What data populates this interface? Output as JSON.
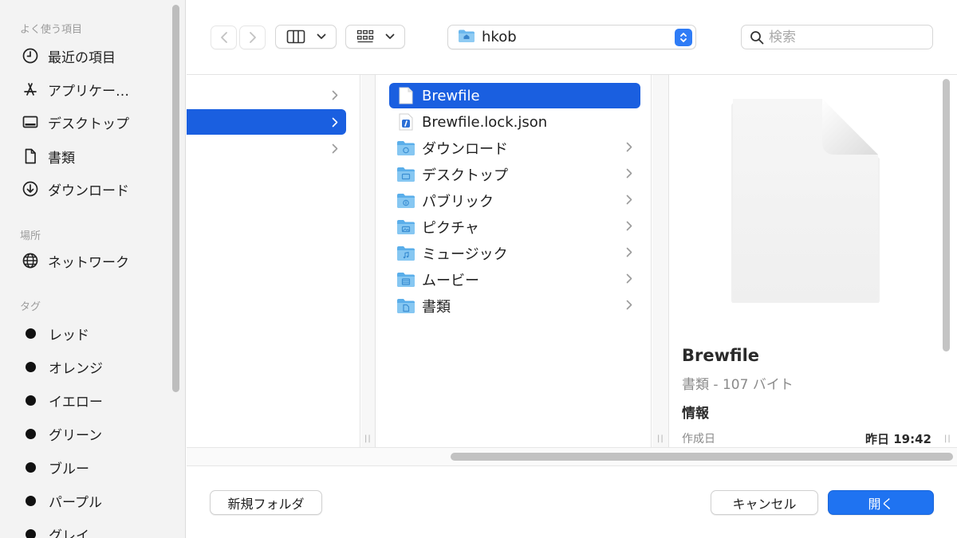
{
  "sidebar": {
    "sections": {
      "recents": "よく使う項目",
      "locations": "場所",
      "tags": "タグ"
    },
    "favorites": [
      {
        "label": "最近の項目",
        "icon": "clock-icon"
      },
      {
        "label": "アプリケー…",
        "icon": "applications-icon"
      },
      {
        "label": "デスクトップ",
        "icon": "desktop-icon"
      },
      {
        "label": "書類",
        "icon": "document-icon"
      },
      {
        "label": "ダウンロード",
        "icon": "download-icon"
      }
    ],
    "locations": [
      {
        "label": "ネットワーク",
        "icon": "network-icon"
      }
    ],
    "tags": [
      {
        "label": "レッド"
      },
      {
        "label": "オレンジ"
      },
      {
        "label": "イエロー"
      },
      {
        "label": "グリーン"
      },
      {
        "label": "ブルー"
      },
      {
        "label": "パープル"
      },
      {
        "label": "グレイ"
      }
    ]
  },
  "toolbar": {
    "path": "hkob",
    "search_placeholder": "検索"
  },
  "files": [
    {
      "name": "Brewfile",
      "type": "file",
      "selected": true
    },
    {
      "name": "Brewfile.lock.json",
      "type": "json",
      "selected": false
    },
    {
      "name": "ダウンロード",
      "type": "folder",
      "selected": false
    },
    {
      "name": "デスクトップ",
      "type": "folder",
      "selected": false
    },
    {
      "name": "パブリック",
      "type": "folder",
      "selected": false
    },
    {
      "name": "ピクチャ",
      "type": "folder",
      "selected": false
    },
    {
      "name": "ミュージック",
      "type": "folder",
      "selected": false
    },
    {
      "name": "ムービー",
      "type": "folder",
      "selected": false
    },
    {
      "name": "書類",
      "type": "folder",
      "selected": false
    }
  ],
  "preview": {
    "name": "Brewfile",
    "kind_size": "書類 - 107 バイト",
    "info_heading": "情報",
    "created_label": "作成日",
    "created_value": "昨日 19:42"
  },
  "buttons": {
    "new_folder": "新規フォルダ",
    "cancel": "キャンセル",
    "open": "開く"
  },
  "colors": {
    "accent": "#1a5fe0",
    "primary_button": "#1f73f1",
    "folder": "#6bb8ee"
  }
}
